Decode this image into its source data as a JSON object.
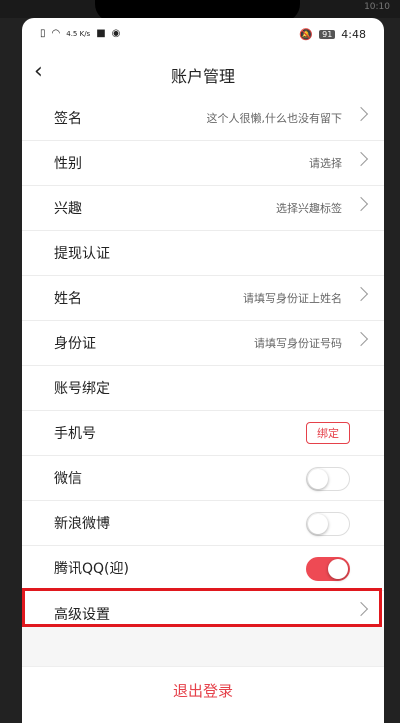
{
  "device": {
    "outer_status_right": "10:10"
  },
  "status_bar": {
    "network_speed": "4.5 K/s",
    "battery": "91",
    "time": "4:48"
  },
  "header": {
    "back_glyph": "‹",
    "title": "账户管理"
  },
  "rows": {
    "signature": {
      "label": "签名",
      "value": "这个人很懒,什么也没有留下"
    },
    "gender": {
      "label": "性别",
      "value": "请选择"
    },
    "interests": {
      "label": "兴趣",
      "value": "选择兴趣标签"
    },
    "withdraw_verify": {
      "label": "提现认证"
    },
    "name": {
      "label": "姓名",
      "value": "请填写身份证上姓名"
    },
    "id_card": {
      "label": "身份证",
      "value": "请填写身份证号码"
    },
    "account_binding": {
      "label": "账号绑定"
    },
    "phone": {
      "label": "手机号",
      "button": "绑定"
    },
    "wechat": {
      "label": "微信",
      "toggle_on": false
    },
    "weibo": {
      "label": "新浪微博",
      "toggle_on": false
    },
    "qq": {
      "label": "腾讯QQ(迎)",
      "toggle_on": true
    },
    "advanced": {
      "label": "高级设置"
    }
  },
  "logout": "退出登录",
  "colors": {
    "accent": "#e5414a",
    "highlight_border": "#e0181e"
  }
}
